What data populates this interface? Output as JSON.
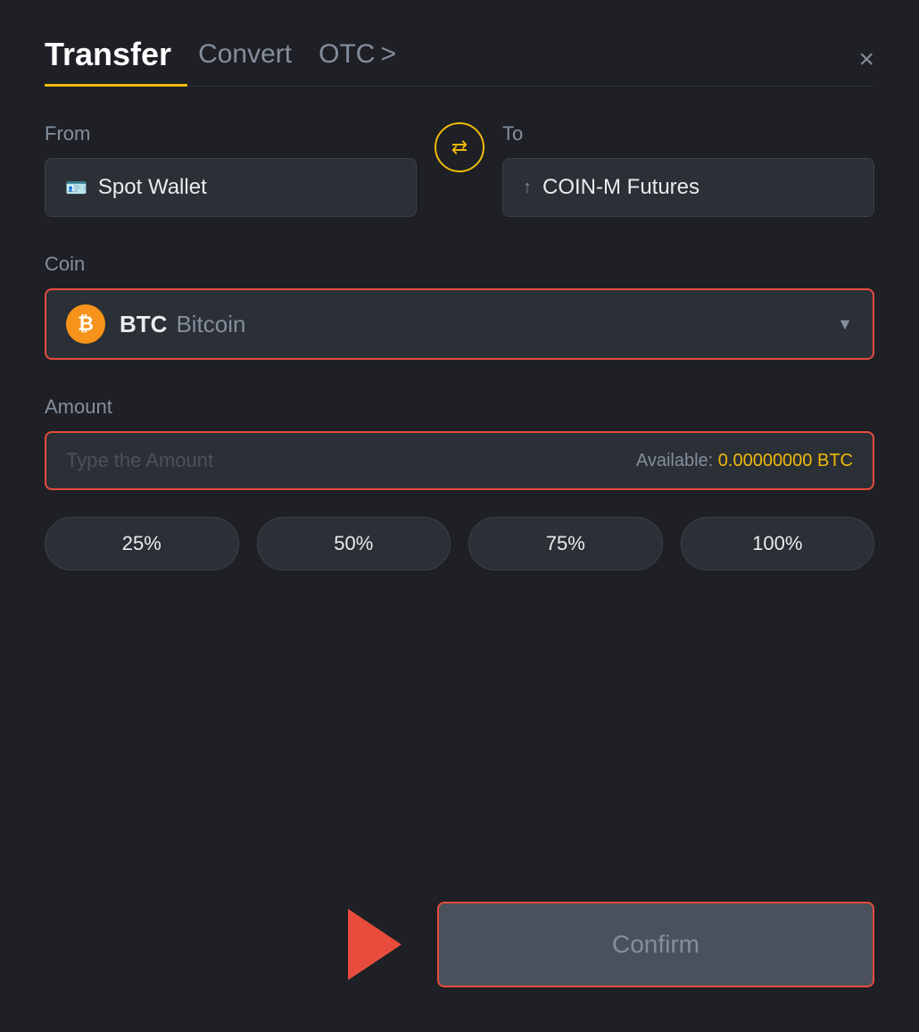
{
  "header": {
    "tab_transfer": "Transfer",
    "tab_convert": "Convert",
    "tab_otc": "OTC",
    "otc_chevron": ">",
    "close_label": "×"
  },
  "from": {
    "label": "From",
    "wallet_icon": "🪪",
    "wallet_name": "Spot Wallet"
  },
  "to": {
    "label": "To",
    "wallet_icon": "↑",
    "wallet_name": "COIN-M Futures"
  },
  "coin": {
    "label": "Coin",
    "symbol": "BTC",
    "name": "Bitcoin",
    "chevron": "▼"
  },
  "amount": {
    "label": "Amount",
    "placeholder": "Type the Amount",
    "available_label": "Available:",
    "available_value": "0.00000000 BTC"
  },
  "percentages": [
    "25%",
    "50%",
    "75%",
    "100%"
  ],
  "confirm_button": "Confirm"
}
